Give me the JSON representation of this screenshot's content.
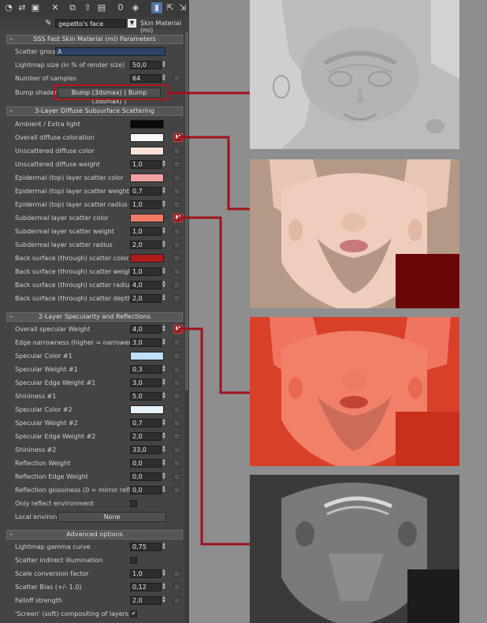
{
  "toolbar": {
    "buttons": [
      "get-material",
      "put-to-scene",
      "assign-to-selection",
      "reset-map",
      "make-copy",
      "make-unique",
      "put-to-library",
      "material-id-channel",
      "show-shaded-in-viewport",
      "show-end-result",
      "go-to-parent",
      "go-forward-to-sibling"
    ]
  },
  "material": {
    "name": "gepetto's face",
    "type": "Skin Material (mi)"
  },
  "rollouts": [
    {
      "title": "SSS Fast Skin Material (mi) Parameters"
    },
    {
      "title": "3-Layer Diffuse Subsurface Scattering"
    },
    {
      "title": "2-Layer Specularity and Reflections"
    },
    {
      "title": "Advanced options"
    }
  ],
  "sss": {
    "scatter_group_label": "Scatter group...",
    "scatter_group_value": "A",
    "lightmap_label": "Lightmap size (in % of render size)",
    "lightmap_value": "50,0",
    "samples_label": "Number of samples",
    "samples_value": "64",
    "bump_label": "Bump shader",
    "bump_value": "Bump (3dsmax)  ( Bump (3dsmax) )"
  },
  "diffuse": {
    "ambient_label": "Ambient / Extra light",
    "ambient_color": "#0a0a0a",
    "overall_label": "Overall diffuse coloration",
    "overall_color": "#f8f8f8",
    "uns_color_label": "Unscattered diffuse color",
    "uns_color": "#fde0d6",
    "uns_weight_label": "Unscattered diffuse weight",
    "uns_weight": "1,0",
    "epi_color_label": "Epidermal (top) layer scatter color",
    "epi_color": "#f0a0a0",
    "epi_weight_label": "Epidermal (top) layer scatter weight",
    "epi_weight": "0,7",
    "epi_radius_label": "Epidermal (top) layer scatter radius",
    "epi_radius": "1,0",
    "sub_color_label": "Subdermal layer scatter color",
    "sub_color": "#f07a65",
    "sub_weight_label": "Subdermal layer scatter weight",
    "sub_weight": "1,0",
    "sub_radius_label": "Subdermal layer scatter radius",
    "sub_radius": "2,0",
    "back_color_label": "Back surface (through) scatter color",
    "back_color": "#b01a1a",
    "back_weight_label": "Back surface (through) scatter weight",
    "back_weight": "1,0",
    "back_radius_label": "Back surface (through) scatter radius",
    "back_radius": "4,0",
    "back_depth_label": "Back surface (through) scatter depth",
    "back_depth": "2,0"
  },
  "spec": {
    "overall_label": "Overall specular Weight",
    "overall_value": "4,0",
    "edge_narrow_label": "Edge narrowness (higher = narrower)",
    "edge_narrow_value": "3,0",
    "color1_label": "Specular Color #1",
    "color1": "#bfe0f8",
    "weight1_label": "Specular Weight #1",
    "weight1": "0,3",
    "edge1_label": "Specular Edge Weight #1",
    "edge1": "3,0",
    "shin1_label": "Shininess #1",
    "shin1": "5,0",
    "color2_label": "Specular Color #2",
    "color2": "#e8f4fc",
    "weight2_label": "Specular Weight #2",
    "weight2": "0,7",
    "edge2_label": "Specular Edge Weight #2",
    "edge2": "2,0",
    "shin2_label": "Shininess #2",
    "shin2": "33,0",
    "refl_weight_label": "Reflection Weight",
    "refl_weight": "0,0",
    "refl_edge_label": "Reflection Edge Weight",
    "refl_edge": "0,0",
    "refl_gloss_label": "Reflection glossiness (0 = mirror reflection)",
    "refl_gloss": "0,0",
    "only_env_label": "Only reflect environment",
    "local_env_label": "Local environ...",
    "local_env_value": "None"
  },
  "advanced": {
    "gamma_label": "Lightmap gamma curve",
    "gamma_value": "0,75",
    "indirect_label": "Scatter indirect illumination",
    "scale_label": "Scale conversion factor",
    "scale_value": "1,0",
    "bias_label": "Scatter Bias (+/- 1.0)",
    "bias_value": "0,12",
    "falloff_label": "Falloff strength",
    "falloff_value": "2,0",
    "screen_label": "'Screen' (soft) compositing of layers",
    "screen_check": "✔"
  },
  "map_button_label": "M",
  "colors": {
    "highlight": "#b0151a",
    "panel": "#444444",
    "background": "#8e8e8e"
  }
}
